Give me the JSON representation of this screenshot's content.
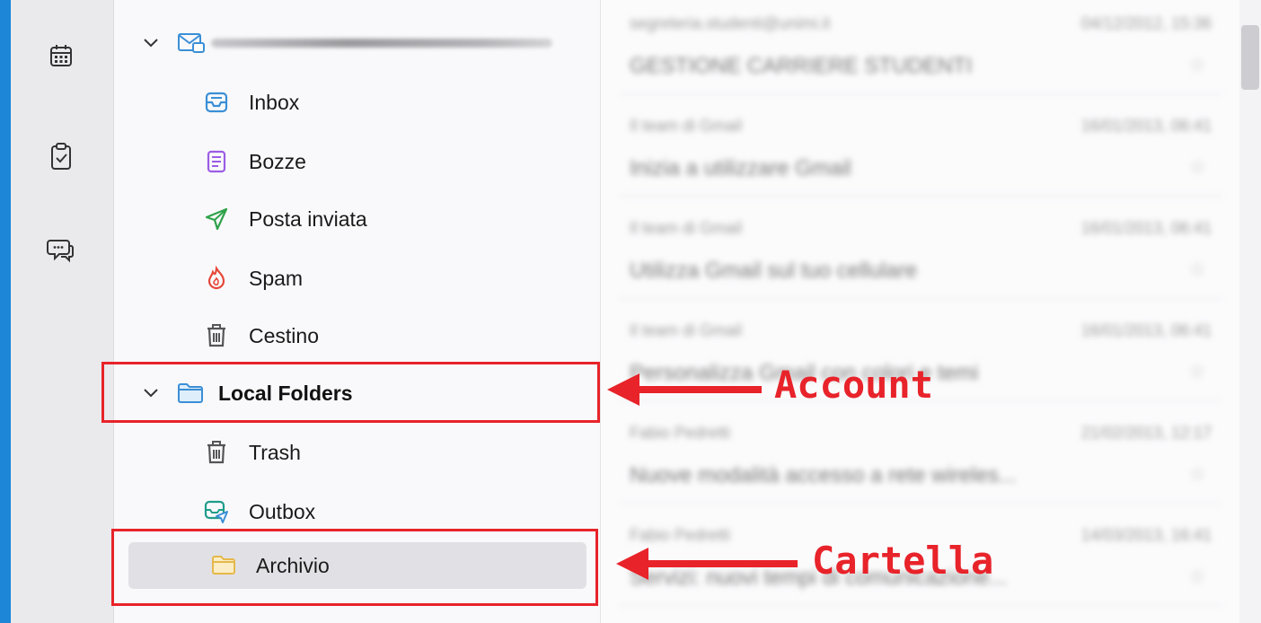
{
  "spaces": {
    "items": [
      {
        "icon": "calendar-icon"
      },
      {
        "icon": "tasks-icon"
      },
      {
        "icon": "chat-icon"
      }
    ]
  },
  "account": {
    "icon": "mail-account-icon",
    "name_blurred": true
  },
  "folders": [
    {
      "label": "Inbox",
      "icon": "inbox-icon",
      "color": "#3b8fd6"
    },
    {
      "label": "Bozze",
      "icon": "drafts-icon",
      "color": "#9b5de5"
    },
    {
      "label": "Posta inviata",
      "icon": "sent-icon",
      "color": "#2fa24a"
    },
    {
      "label": "Spam",
      "icon": "spam-icon",
      "color": "#e5473a"
    },
    {
      "label": "Cestino",
      "icon": "trash-icon",
      "color": "#555558"
    }
  ],
  "local_folders": {
    "label": "Local Folders",
    "icon": "folder-icon",
    "items": [
      {
        "label": "Trash",
        "icon": "trash-icon",
        "color": "#555558"
      },
      {
        "label": "Outbox",
        "icon": "outbox-icon",
        "color": "#1f9d8a"
      },
      {
        "label": "Archivio",
        "icon": "folder-icon",
        "color": "#e6b84a",
        "selected": true
      }
    ]
  },
  "messages": [
    {
      "sender": "segreteria.studenti@unimi.it",
      "date": "04/12/2012, 15:36",
      "subject": "GESTIONE CARRIERE STUDENTI"
    },
    {
      "sender": "Il team di Gmail",
      "date": "16/01/2013, 06:41",
      "subject": "Inizia a utilizzare Gmail"
    },
    {
      "sender": "Il team di Gmail",
      "date": "16/01/2013, 06:41",
      "subject": "Utilizza Gmail sul tuo cellulare"
    },
    {
      "sender": "Il team di Gmail",
      "date": "16/01/2013, 06:41",
      "subject": "Personalizza Gmail con colori e temi"
    },
    {
      "sender": "Fabio Pedretti",
      "date": "21/02/2013, 12:17",
      "subject": "Nuove modalità accesso a rete wireles..."
    },
    {
      "sender": "Fabio Pedretti",
      "date": "14/03/2013, 16:41",
      "subject": "Servizi: nuovi tempi di comunicazione..."
    }
  ],
  "annotations": {
    "account_label": "Account",
    "folder_label": "Cartella",
    "color": "#e8232a"
  }
}
